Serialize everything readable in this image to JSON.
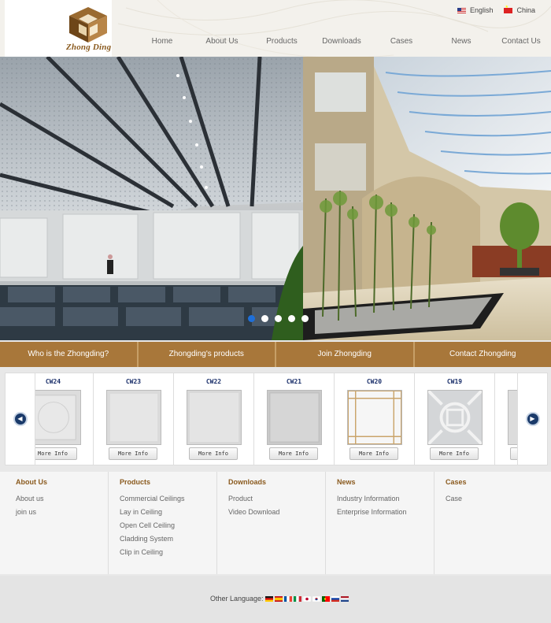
{
  "brand": {
    "name": "Zhong Ding"
  },
  "languages": [
    {
      "label": "English",
      "icon": "us-flag-icon"
    },
    {
      "label": "China",
      "icon": "china-flag-icon"
    }
  ],
  "nav": [
    "Home",
    "About Us",
    "Products",
    "Downloads",
    "Cases",
    "News",
    "Contact Us"
  ],
  "banner": {
    "slides": 5,
    "active_slide": 1
  },
  "tabs": [
    "Who is the Zhongding?",
    "Zhongding's products",
    "Join Zhongding",
    "Contact Zhongding"
  ],
  "products": [
    {
      "code": "CW24",
      "button": "More Info"
    },
    {
      "code": "CW23",
      "button": "More Info"
    },
    {
      "code": "CW22",
      "button": "More Info"
    },
    {
      "code": "CW21",
      "button": "More Info"
    },
    {
      "code": "CW20",
      "button": "More Info"
    },
    {
      "code": "CW19",
      "button": "More Info"
    }
  ],
  "footer": [
    {
      "title": "About Us",
      "links": [
        "About us",
        "join us"
      ]
    },
    {
      "title": "Products",
      "links": [
        "Commercial Ceilings",
        "Lay in Ceiling",
        "Open Cell Ceiling",
        "Cladding System",
        "Clip in Ceiling"
      ]
    },
    {
      "title": "Downloads",
      "links": [
        "Product",
        "Video Download"
      ]
    },
    {
      "title": "News",
      "links": [
        "Industry Information",
        "Enterprise Information"
      ]
    },
    {
      "title": "Cases",
      "links": [
        "Case"
      ]
    }
  ],
  "other_language": {
    "label": "Other Language:"
  },
  "colors": {
    "accent": "#a8773a",
    "brand_text": "#8a5a1e",
    "dot_active": "#1e6fd9"
  }
}
